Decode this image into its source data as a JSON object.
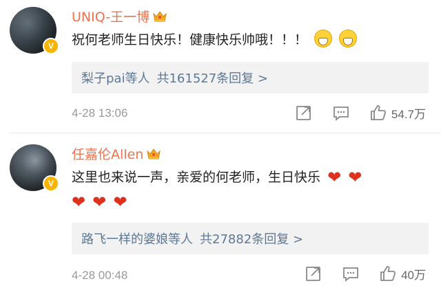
{
  "comments": [
    {
      "username": "UNIQ-王一博",
      "text": "祝何老师生日快乐！健康快乐帅哦！！！",
      "emoji": [
        "grin-emoji",
        "grin-emoji"
      ],
      "replies": {
        "users": "梨子pai等人",
        "count": "共161527条回复 >"
      },
      "time": "4-28 13:06",
      "likes": "54.7万",
      "badge": "V"
    },
    {
      "username": "任嘉伦Allen",
      "text": "这里也来说一声，亲爱的何老师，生日快乐",
      "emoji": [
        "heart",
        "heart",
        "heart",
        "heart",
        "heart"
      ],
      "replies": {
        "users": "路飞一样的婆娘等人",
        "count": "共27882条回复 >"
      },
      "time": "4-28 00:48",
      "likes": "40万",
      "badge": "V"
    }
  ],
  "colors": {
    "username": "#eb7350",
    "link": "#5d7895",
    "meta": "#999999",
    "badge": "#f7b500",
    "heart": "#e0301e"
  },
  "icons": {
    "share": "share-icon",
    "comment": "comment-icon",
    "like": "like-icon",
    "crown": "crown-icon"
  }
}
